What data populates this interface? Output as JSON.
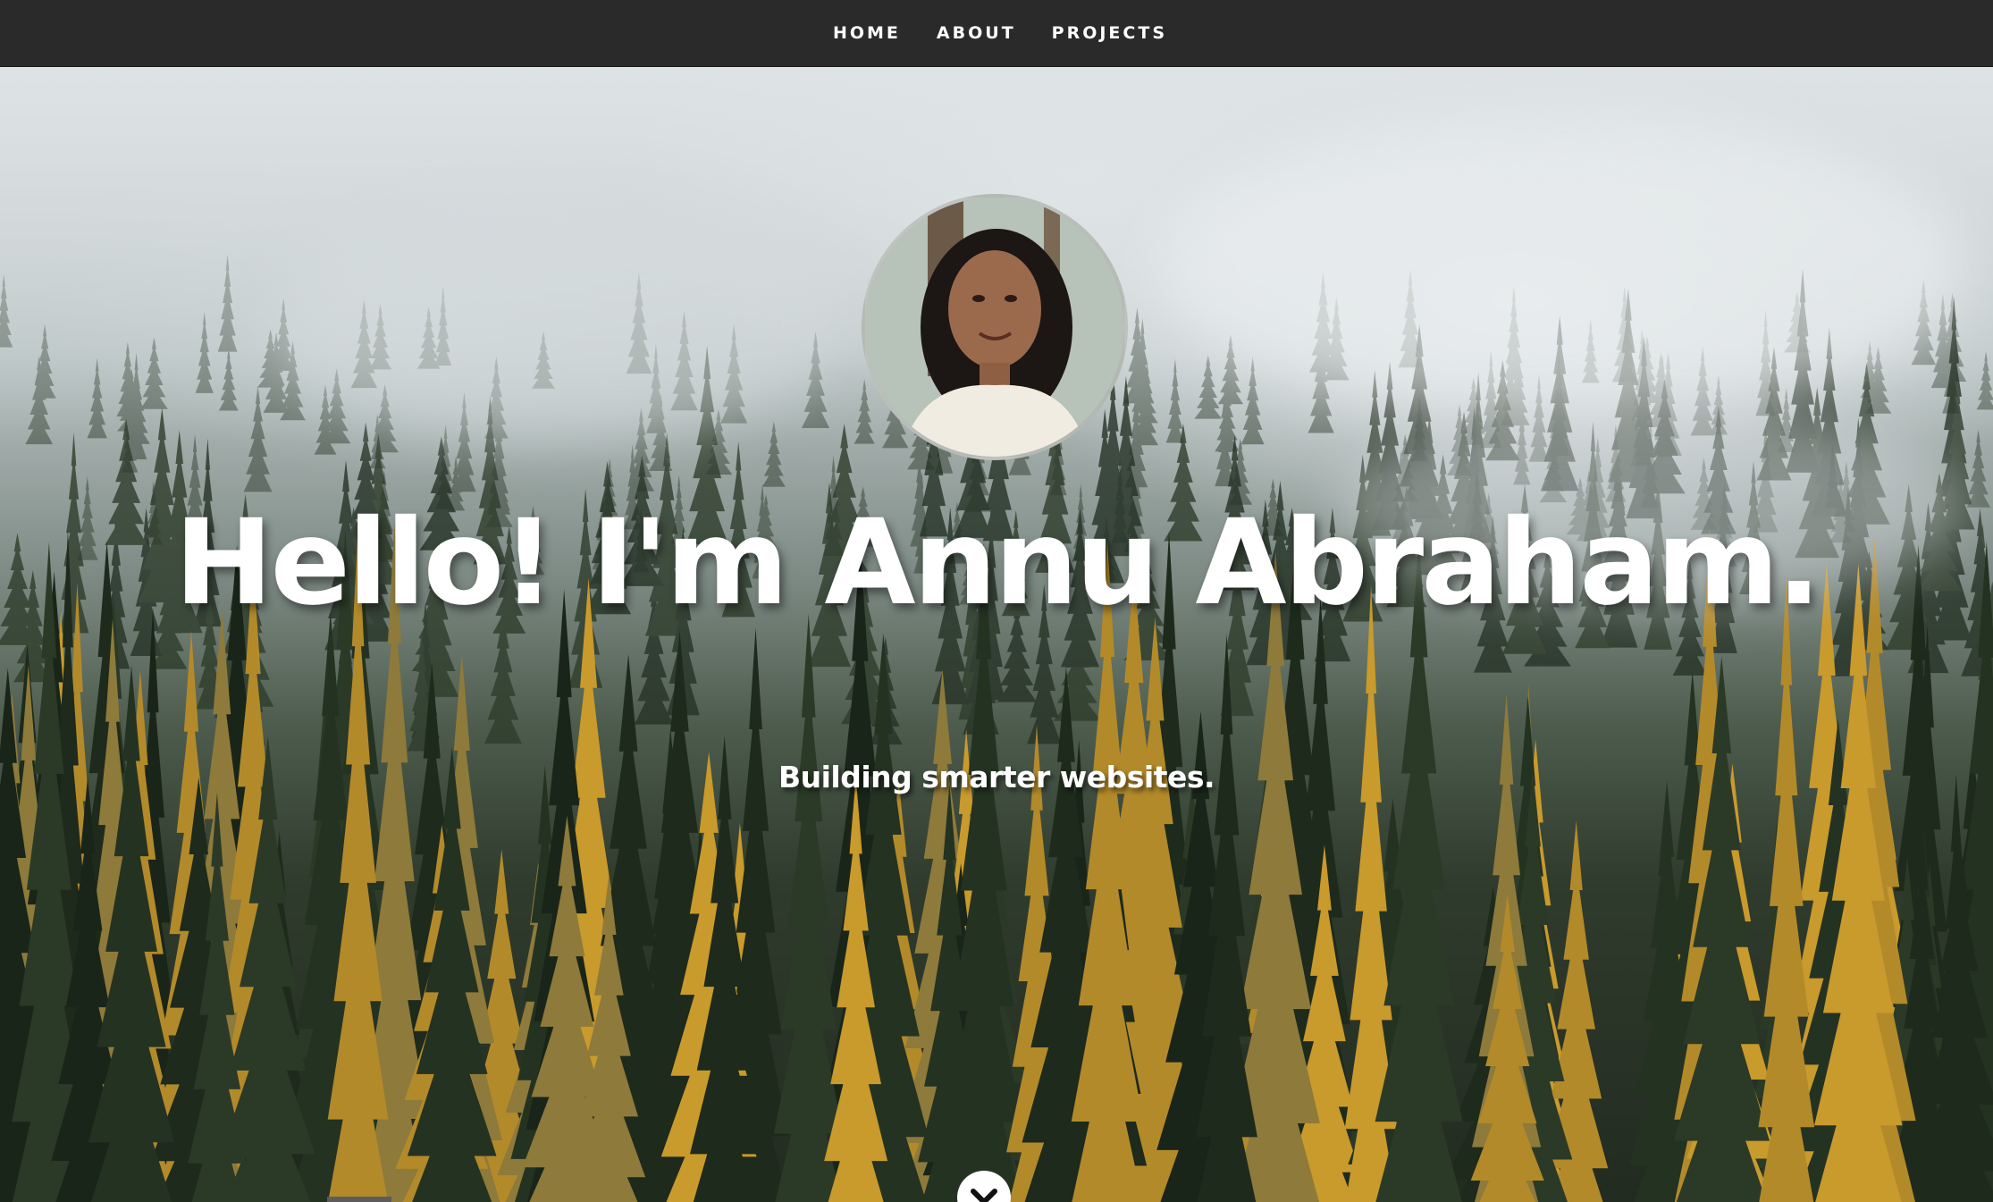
{
  "nav": {
    "items": [
      {
        "label": "HOME"
      },
      {
        "label": "ABOUT"
      },
      {
        "label": "PROJECTS"
      }
    ]
  },
  "hero": {
    "title": "Hello! I'm Annu Abraham.",
    "subtitle": "Building smarter websites.",
    "avatar_icon": "profile-photo",
    "scroll_icon": "chevron-down-icon"
  },
  "colors": {
    "navbar_bg": "#2a2a2a",
    "nav_text": "#ffffff",
    "hero_text": "#ffffff"
  }
}
